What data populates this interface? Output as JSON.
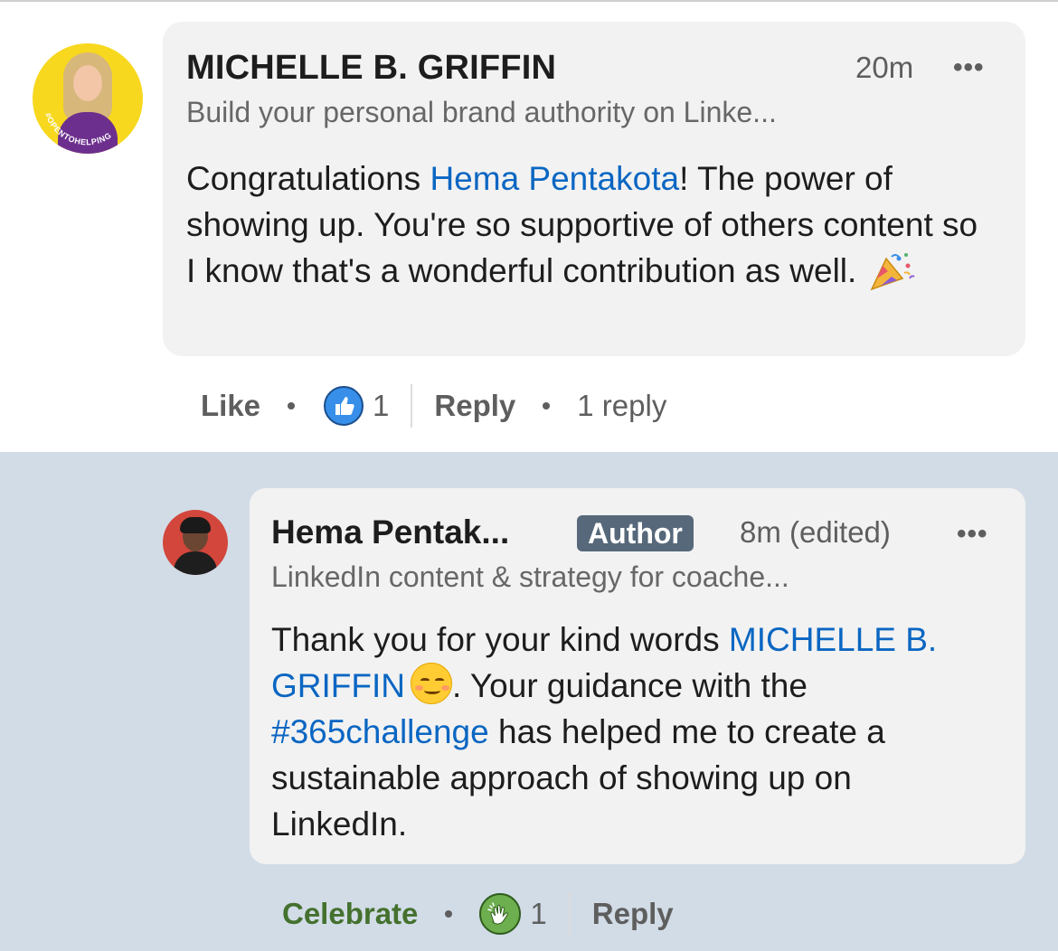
{
  "comment": {
    "author_name": "MICHELLE B. GRIFFIN",
    "time": "20m",
    "more_label": "•••",
    "headline": "Build your personal brand authority on Linke...",
    "avatar_ring_text": "#OPENTOHELPING",
    "body": {
      "prefix": "Congratulations ",
      "mention": "Hema Pentakota",
      "suffix": "! The power of showing up. You're so supportive of others content so I know that's a wonderful contribution as well. ",
      "emoji": "party-popper-emoji"
    },
    "actions": {
      "like_label": "Like",
      "reaction_icon": "thumbs-up-icon",
      "reaction_count": "1",
      "reply_label": "Reply",
      "replies_label": "1 reply"
    }
  },
  "reply": {
    "author_name": "Hema Pentak...",
    "author_badge": "Author",
    "time": "8m (edited)",
    "more_label": "•••",
    "headline": "LinkedIn content & strategy for coache...",
    "body": {
      "prefix": "Thank you for your kind words ",
      "mention": "MICHELLE B. GRIFFIN",
      "emoji": "smiling-face-emoji",
      "middle": ". Your guidance with the ",
      "hashtag": "#365challenge",
      "suffix": " has helped me to create a sustainable approach of showing up on LinkedIn."
    },
    "actions": {
      "celebrate_label": "Celebrate",
      "reaction_icon": "clapping-hands-icon",
      "reaction_count": "1",
      "reply_label": "Reply"
    }
  },
  "colors": {
    "link": "#0a66c2",
    "bubble": "#f2f2f2",
    "highlight_background": "#d2dce7",
    "celebrate": "#44712e",
    "author_badge": "#56687a"
  }
}
